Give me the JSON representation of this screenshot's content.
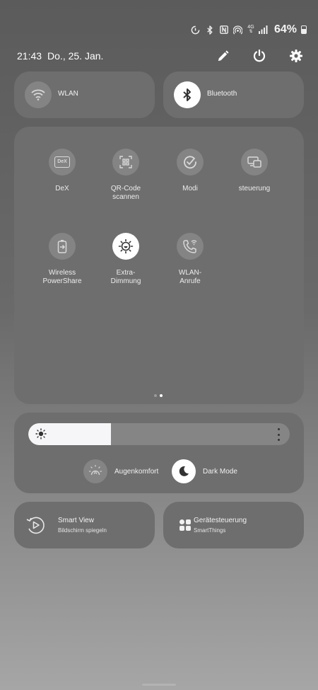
{
  "status_bar": {
    "network": "4G",
    "battery": "64%",
    "icons": [
      "data-saver-icon",
      "bluetooth-icon",
      "nfc-icon",
      "hotspot-icon",
      "4g-icon",
      "signal-icon",
      "battery-icon"
    ]
  },
  "header": {
    "time": "21:43",
    "date": "Do., 25. Jan.",
    "edit_icon": "pencil-icon",
    "power_icon": "power-icon",
    "settings_icon": "gear-icon"
  },
  "toggles": {
    "wlan": "WLAN",
    "bluetooth": "Bluetooth"
  },
  "tiles": {
    "dex": "DeX",
    "dex_badge": "DeX",
    "qr_line1": "QR-Code",
    "qr_line2": "scannen",
    "modi": "Modi",
    "steuerung": "steuerung",
    "wireless_line1": "Wireless",
    "wireless_line2": "PowerShare",
    "extra_line1": "Extra-",
    "extra_line2": "Dimmung",
    "wlan_call_line1": "WLAN-",
    "wlan_call_line2": "Anrufe"
  },
  "pager": {
    "pages": 2,
    "current": 2
  },
  "brightness": {
    "level": 0.315,
    "eye_comfort": "Augenkomfort",
    "dark_mode": "Dark Mode"
  },
  "bottom": {
    "smart_view_title": "Smart View",
    "smart_view_sub": "Bildschirm spiegeln",
    "devices_title": "Gerätesteuerung",
    "devices_sub": "SmartThings"
  },
  "colors": {
    "panel": "#6e6e6e",
    "tile_circle": "#848484",
    "active": "#ffffff"
  }
}
